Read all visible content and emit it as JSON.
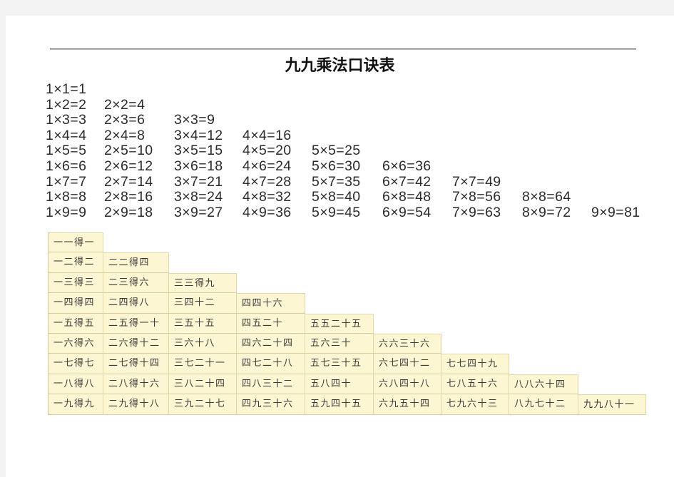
{
  "document": {
    "title": "九九乘法口诀表"
  },
  "formulas": [
    [
      "1×1=1"
    ],
    [
      "1×2=2",
      "2×2=4"
    ],
    [
      "1×3=3",
      "2×3=6",
      "3×3=9"
    ],
    [
      "1×4=4",
      "2×4=8",
      "3×4=12",
      "4×4=16"
    ],
    [
      "1×5=5",
      "2×5=10",
      "3×5=15",
      "4×5=20",
      "5×5=25"
    ],
    [
      "1×6=6",
      "2×6=12",
      "3×6=18",
      "4×6=24",
      "5×6=30",
      "6×6=36"
    ],
    [
      "1×7=7",
      "2×7=14",
      "3×7=21",
      "4×7=28",
      "5×7=35",
      "6×7=42",
      "7×7=49"
    ],
    [
      "1×8=8",
      "2×8=16",
      "3×8=24",
      "4×8=32",
      "5×8=40",
      "6×8=48",
      "7×8=56",
      "8×8=64"
    ],
    [
      "1×9=9",
      "2×9=18",
      "3×9=27",
      "4×9=36",
      "5×9=45",
      "6×9=54",
      "7×9=63",
      "8×9=72",
      "9×9=81"
    ]
  ],
  "rhymes": [
    [
      "一一得一"
    ],
    [
      "一二得二",
      "二二得四"
    ],
    [
      "一三得三",
      "二三得六",
      "三三得九"
    ],
    [
      "一四得四",
      "二四得八",
      "三四十二",
      "四四十六"
    ],
    [
      "一五得五",
      "二五得一十",
      "三五十五",
      "四五二十",
      "五五二十五"
    ],
    [
      "一六得六",
      "二六得十二",
      "三六十八",
      "四六二十四",
      "五六三十",
      "六六三十六"
    ],
    [
      "一七得七",
      "二七得十四",
      "三七二十一",
      "四七二十八",
      "五七三十五",
      "六七四十二",
      "七七四十九"
    ],
    [
      "一八得八",
      "二八得十六",
      "三八二十四",
      "四八三十二",
      "五八四十",
      "六八四十八",
      "七八五十六",
      "八八六十四"
    ],
    [
      "一九得九",
      "二九得十八",
      "三九二十七",
      "四九三十六",
      "五九四十五",
      "六九五十四",
      "七九六十三",
      "八九七十二",
      "九九八十一"
    ]
  ],
  "colors": {
    "cell_background": "#fdf6d3",
    "cell_border": "#e2d7a7",
    "text": "#2b2b2b"
  }
}
